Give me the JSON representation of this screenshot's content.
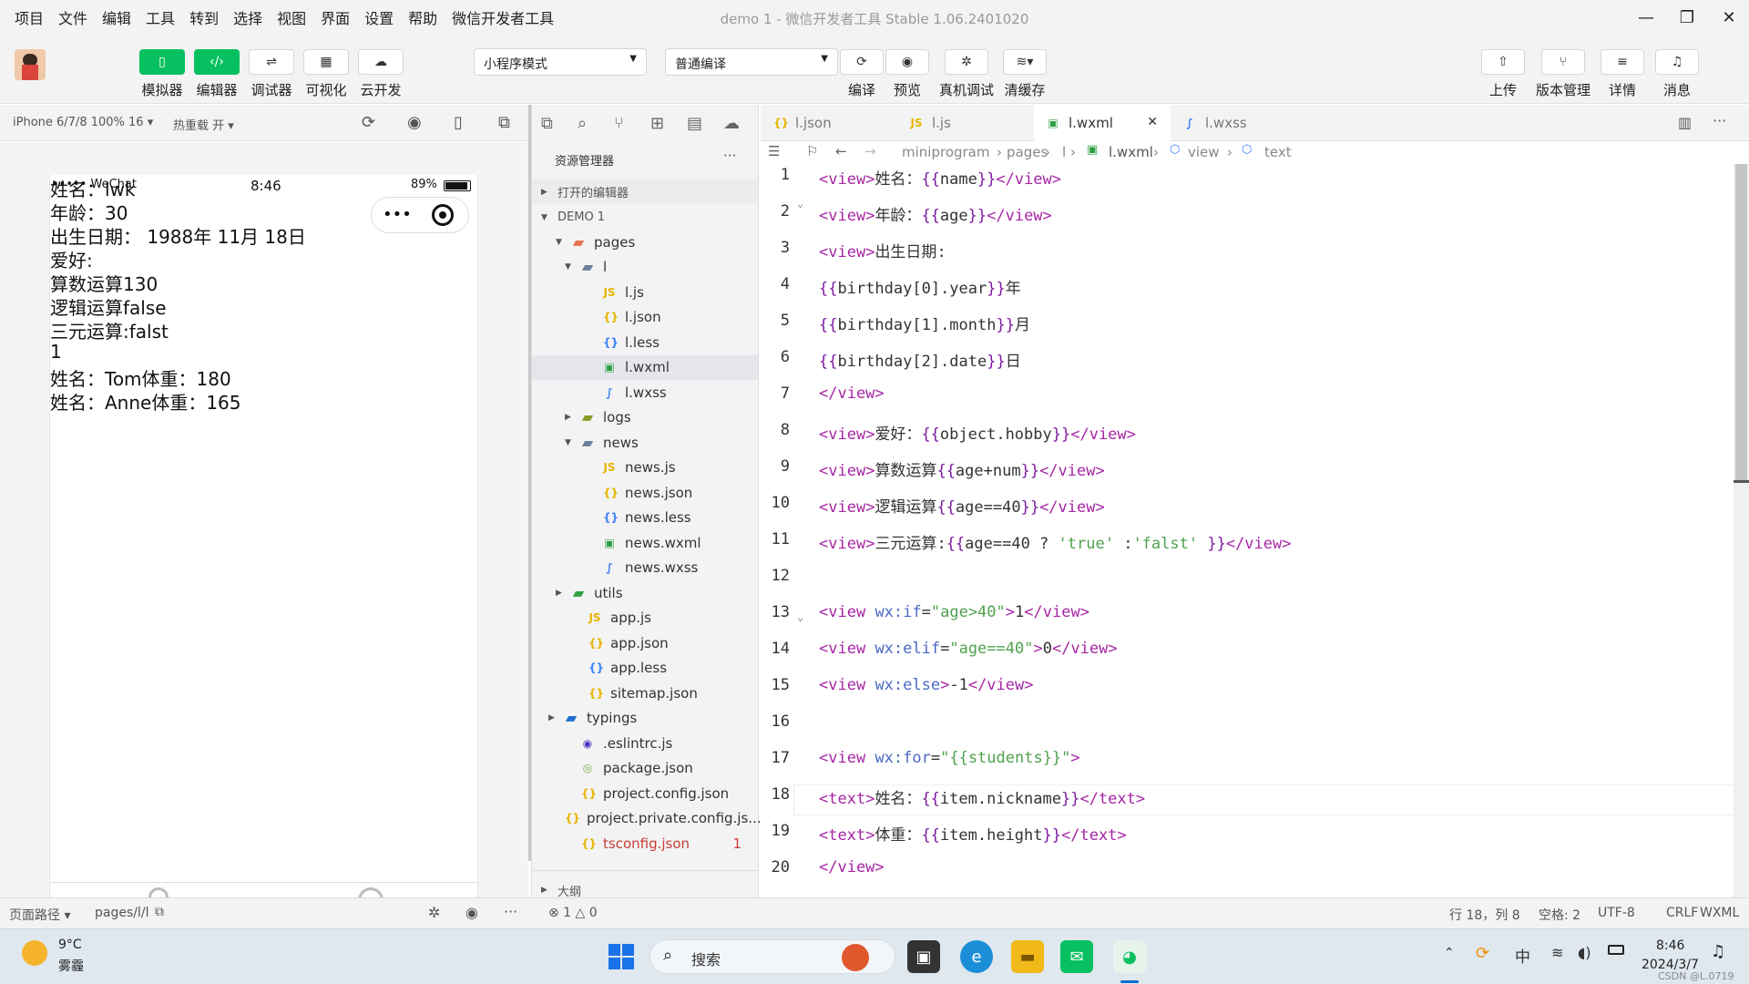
{
  "menu": [
    "项目",
    "文件",
    "编辑",
    "工具",
    "转到",
    "选择",
    "视图",
    "界面",
    "设置",
    "帮助",
    "微信开发者工具"
  ],
  "window_title": "demo 1 - 微信开发者工具 Stable 1.06.2401020",
  "toolbar": {
    "buttons": [
      "模拟器",
      "编辑器",
      "调试器",
      "可视化",
      "云开发"
    ],
    "mode_select": "小程序模式",
    "compile_select": "普通编译",
    "actions": [
      "编译",
      "预览",
      "真机调试",
      "清缓存"
    ],
    "right": [
      "上传",
      "版本管理",
      "详情",
      "消息"
    ]
  },
  "simbar": {
    "device": "iPhone 6/7/8 100% 16 ▾",
    "hot": "热重载 开 ▾"
  },
  "phone": {
    "status_carrier": "••••• WeChat",
    "status_time": "8:46",
    "status_battery": "89%",
    "lines": [
      "姓名：lwk",
      "年龄：30",
      "出生日期：  1988年 11月 18日",
      "爱好:",
      "算数运算130",
      "逻辑运算false",
      "三元运算:falst",
      "1",
      "姓名：Tom体重：180",
      "姓名：Anne体重：165"
    ]
  },
  "explorer": {
    "title": "资源管理器",
    "open_editors": "打开的编辑器",
    "project": "DEMO 1",
    "tree": [
      "pages",
      "l",
      "l.js",
      "l.json",
      "l.less",
      "l.wxml",
      "l.wxss",
      "logs",
      "news",
      "news.js",
      "news.json",
      "news.less",
      "news.wxml",
      "news.wxss",
      "utils",
      "app.js",
      "app.json",
      "app.less",
      "sitemap.json",
      "typings",
      ".eslintrc.js",
      "package.json",
      "project.config.json",
      "project.private.config.js...",
      "tsconfig.json"
    ],
    "tsconfig_badge": "1",
    "outline": "大纲"
  },
  "tabs": [
    "l.json",
    "l.js",
    "l.wxml",
    "l.wxss"
  ],
  "breadcrumb": [
    "miniprogram",
    "pages",
    "l",
    "l.wxml",
    "view",
    "text"
  ],
  "code_lines": [
    "<view>姓名：{{name}}</view>",
    "<view>年龄：{{age}}</view>",
    "<view>出生日期:",
    "{{birthday[0].year}}年",
    "{{birthday[1].month}}月",
    "{{birthday[2].date}}日",
    "</view>",
    "<view>爱好：{{object.hobby}}</view>",
    "<view>算数运算{{age+num}}</view>",
    "<view>逻辑运算{{age==40}}</view>",
    "<view>三元运算:{{age==40 ? 'true' :'falst' }}</view>",
    "",
    "<view wx:if=\"age>40\">1</view>",
    "<view wx:elif=\"age==40\">0</view>",
    "<view wx:else>-1</view>",
    "",
    "<view wx:for=\"{{students}}\">",
    "<text>姓名：{{item.nickname}}</text>",
    "<text>体重：{{item.height}}</text>",
    "</view>"
  ],
  "statusbar": {
    "page_path": "页面路径 ▾",
    "path": "pages/l/l",
    "problems": "⊗ 1 △ 0",
    "cursor": "行 18，列 8",
    "spaces": "空格: 2",
    "encoding": "UTF-8",
    "eol": "CRLF",
    "lang": "WXML"
  },
  "taskbar": {
    "weather_temp": "9°C",
    "weather_desc": "雾霾",
    "search": "搜索",
    "ime": "中",
    "time": "8:46",
    "date": "2024/3/7",
    "watermark": "CSDN @L.0719"
  },
  "colors": {
    "green": "#07c160",
    "tag": "#a626a4",
    "string": "#50a14f",
    "mustache": "#7c1aa0"
  }
}
